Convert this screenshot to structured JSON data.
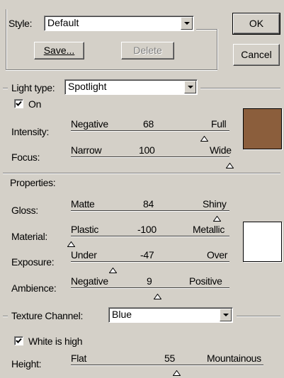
{
  "style": {
    "label": "Style:",
    "value": "Default",
    "save_label": "Save...",
    "delete_label": "Delete"
  },
  "buttons": {
    "ok": "OK",
    "cancel": "Cancel"
  },
  "light": {
    "type_label": "Light type:",
    "type_value": "Spotlight",
    "on_label": "On",
    "on_checked": true,
    "color": "#8b5e3c",
    "sliders": [
      {
        "label": "Intensity:",
        "min_label": "Negative",
        "value": "68",
        "max_label": "Full",
        "level": 0.84
      },
      {
        "label": "Focus:",
        "min_label": "Narrow",
        "value": "100",
        "max_label": "Wide",
        "level": 1.0
      }
    ]
  },
  "properties": {
    "title": "Properties:",
    "color": "#ffffff",
    "sliders": [
      {
        "label": "Gloss:",
        "min_label": "Matte",
        "value": "84",
        "max_label": "Shiny",
        "level": 0.92
      },
      {
        "label": "Material:",
        "min_label": "Plastic",
        "value": "-100",
        "max_label": "Metallic",
        "level": 0.0
      },
      {
        "label": "Exposure:",
        "min_label": "Under",
        "value": "-47",
        "max_label": "Over",
        "level": 0.265
      },
      {
        "label": "Ambience:",
        "min_label": "Negative",
        "value": "9",
        "max_label": "Positive",
        "level": 0.545
      }
    ]
  },
  "texture": {
    "channel_label": "Texture Channel:",
    "channel_value": "Blue",
    "white_high_label": "White is high",
    "white_high_checked": true,
    "height": {
      "label": "Height:",
      "min_label": "Flat",
      "value": "55",
      "max_label": "Mountainous",
      "level": 0.55
    }
  }
}
